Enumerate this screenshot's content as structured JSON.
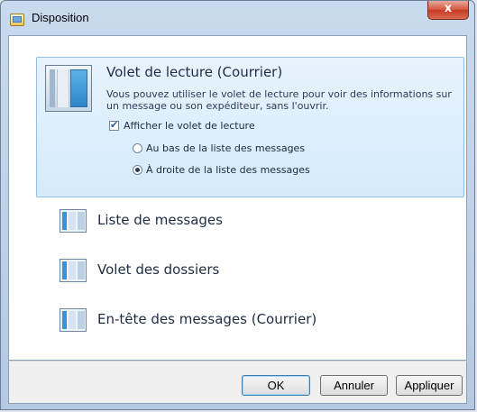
{
  "window": {
    "title": "Disposition",
    "close_glyph": "x"
  },
  "reading_pane": {
    "title": "Volet de lecture (Courrier)",
    "description": "Vous pouvez utiliser le volet de lecture pour voir des informations sur un message ou son expéditeur, sans l'ouvrir.",
    "show_checkbox": {
      "label": "Afficher le volet de lecture",
      "checked": true
    },
    "options": [
      {
        "label": "Au bas de la liste des messages",
        "selected": false
      },
      {
        "label": "À droite de la liste des messages",
        "selected": true
      }
    ],
    "icon": "reading-pane-layout-icon"
  },
  "items": [
    {
      "label": "Liste de messages",
      "icon": "message-list-layout-icon"
    },
    {
      "label": "Volet des dossiers",
      "icon": "folder-pane-layout-icon"
    },
    {
      "label": "En-tête des messages (Courrier)",
      "icon": "message-headers-layout-icon"
    }
  ],
  "buttons": {
    "ok": "OK",
    "cancel": "Annuler",
    "apply": "Appliquer"
  },
  "colors": {
    "selected_panel_bg": "#dcecfb",
    "selected_panel_border": "#8ec2ea",
    "close_button": "#c9452d"
  }
}
